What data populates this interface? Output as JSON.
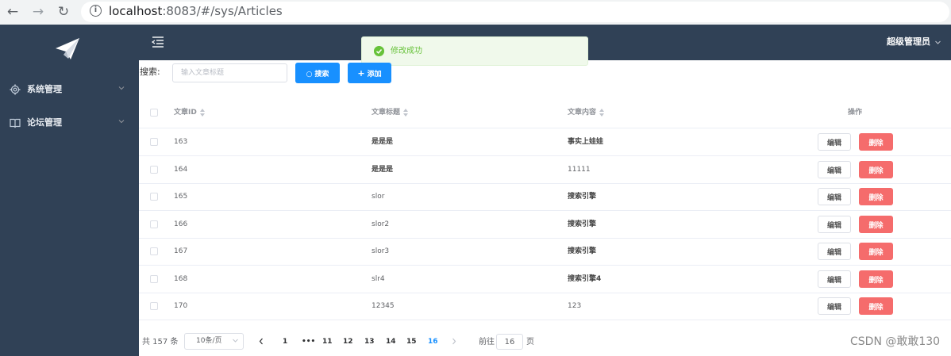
{
  "browser": {
    "url_host": "localhost",
    "url_rest": ":8083/#/sys/Articles"
  },
  "sidebar": {
    "items": [
      {
        "label": "系统管理",
        "icon": "gear-icon"
      },
      {
        "label": "论坛管理",
        "icon": "book-icon"
      }
    ]
  },
  "header": {
    "user": "超级管理员"
  },
  "toast": {
    "message": "修改成功",
    "color": "#67c23a"
  },
  "search": {
    "label": "搜索:",
    "placeholder": "输入文章标题",
    "search_button": "搜索",
    "add_button": "添加"
  },
  "table": {
    "columns": [
      "文章ID",
      "文章标题",
      "文章内容",
      "操作"
    ],
    "edit_label": "编辑",
    "delete_label": "删除",
    "rows": [
      {
        "id": "163",
        "title": "是是是",
        "content": "事实上娃娃"
      },
      {
        "id": "164",
        "title": "是是是",
        "content": "11111"
      },
      {
        "id": "165",
        "title": "slor",
        "content": "搜索引擎"
      },
      {
        "id": "166",
        "title": "slor2",
        "content": "搜索引擎"
      },
      {
        "id": "167",
        "title": "slor3",
        "content": "搜索引擎"
      },
      {
        "id": "168",
        "title": "slr4",
        "content": "搜索引擎4"
      },
      {
        "id": "170",
        "title": "12345",
        "content": "123"
      }
    ]
  },
  "pagination": {
    "total": "共 157 条",
    "page_size": "10条/页",
    "pages": [
      "1",
      "•••",
      "11",
      "12",
      "13",
      "14",
      "15",
      "16"
    ],
    "current": "16",
    "goto_label": "前往",
    "goto_value": "16",
    "page_suffix": "页"
  },
  "watermark": "CSDN @敢敢130",
  "colors": {
    "sidebar": "#304156",
    "primary": "#1890ff",
    "danger": "#f56c6c"
  }
}
